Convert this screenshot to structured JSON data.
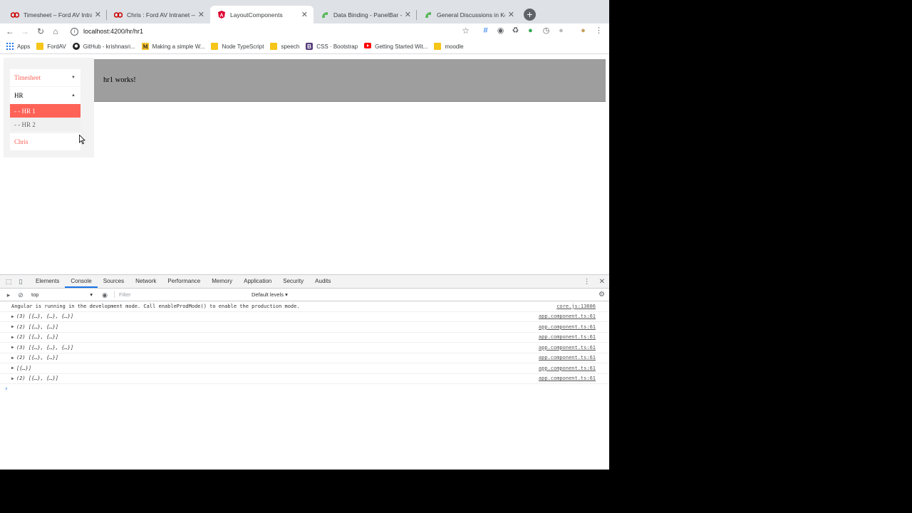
{
  "browser": {
    "tabs": [
      {
        "title": "Timesheet – Ford AV Intranet",
        "favicon": "ford-logo-icon",
        "active": false
      },
      {
        "title": "Chris : Ford AV Intranet — Wiki",
        "favicon": "ford-logo-icon",
        "active": false
      },
      {
        "title": "LayoutComponents",
        "favicon": "angular-icon",
        "active": true
      },
      {
        "title": "Data Binding - PanelBar - Kendo UI",
        "favicon": "kendo-icon",
        "active": false
      },
      {
        "title": "General Discussions in Kendo UI",
        "favicon": "kendo-icon",
        "active": false
      }
    ],
    "url": "localhost:4200/hr/hr1",
    "bookmarks": [
      {
        "label": "Apps",
        "icon": "apps-grid-icon"
      },
      {
        "label": "FordAV",
        "icon": "folder-icon"
      },
      {
        "label": "GitHub - krishnasri...",
        "icon": "github-icon"
      },
      {
        "label": "Making a simple W...",
        "icon": "medium-icon"
      },
      {
        "label": "Node TypeScript",
        "icon": "folder-icon"
      },
      {
        "label": "speech",
        "icon": "folder-icon"
      },
      {
        "label": "CSS · Bootstrap",
        "icon": "bootstrap-icon"
      },
      {
        "label": "Getting Started Wit...",
        "icon": "youtube-icon"
      },
      {
        "label": "moodle",
        "icon": "folder-icon"
      }
    ]
  },
  "page": {
    "panelbar": {
      "timesheet": "Timesheet",
      "hr": "HR",
      "hr_children": [
        "- - HR 1",
        "- - HR 2"
      ],
      "selected_child": "- - HR 1",
      "chris": "Chris"
    },
    "banner_text": "hr1 works!"
  },
  "devtools": {
    "tabs": [
      "Elements",
      "Console",
      "Sources",
      "Network",
      "Performance",
      "Memory",
      "Application",
      "Security",
      "Audits"
    ],
    "active_tab": "Console",
    "context": "top",
    "filter_placeholder": "Filter",
    "levels": "Default levels",
    "logs": [
      {
        "text": "Angular is running in the development mode. Call enableProdMode() to enable the production mode.",
        "source": "core.js:13606",
        "expandable": false
      },
      {
        "text": "(3) [{…}, {…}, {…}]",
        "source": "app.component.ts:61",
        "expandable": true
      },
      {
        "text": "(2) [{…}, {…}]",
        "source": "app.component.ts:61",
        "expandable": true
      },
      {
        "text": "(2) [{…}, {…}]",
        "source": "app.component.ts:61",
        "expandable": true
      },
      {
        "text": "(3) [{…}, {…}, {…}]",
        "source": "app.component.ts:61",
        "expandable": true
      },
      {
        "text": "(2) [{…}, {…}]",
        "source": "app.component.ts:61",
        "expandable": true
      },
      {
        "text": "[{…}]",
        "source": "app.component.ts:61",
        "expandable": true
      },
      {
        "text": "(2) [{…}, {…}]",
        "source": "app.component.ts:61",
        "expandable": true
      }
    ]
  },
  "colors": {
    "accent": "#ff6358",
    "banner": "#9e9e9e",
    "sidebar_bg": "#f3f3f3"
  }
}
